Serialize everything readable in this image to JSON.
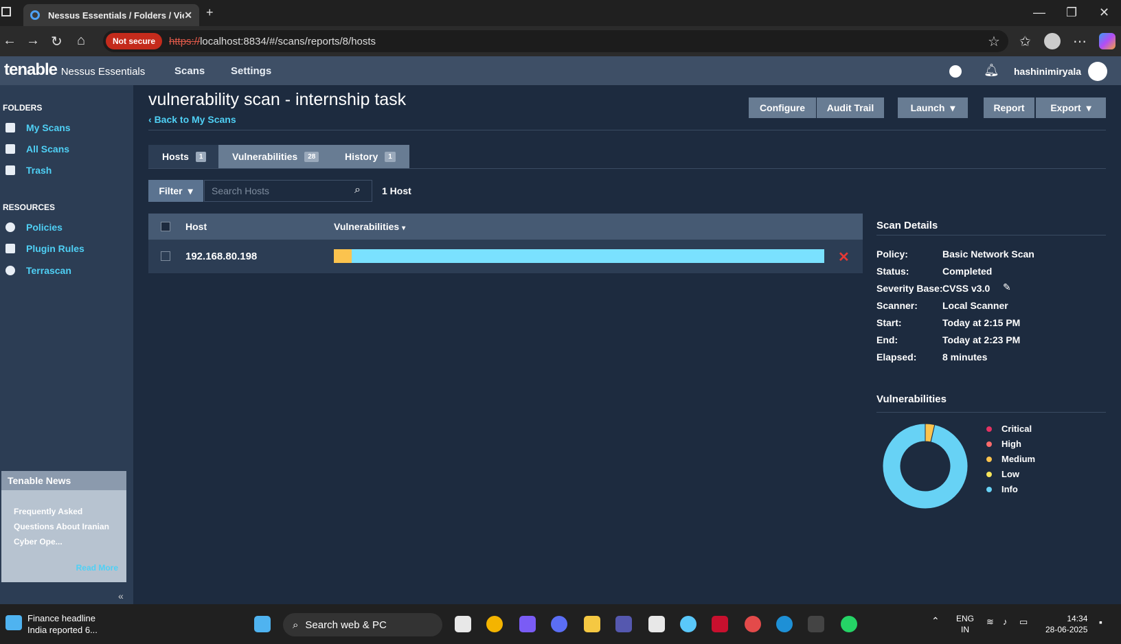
{
  "browser": {
    "tab_title": "Nessus Essentials / Folders / View",
    "not_secure": "Not secure",
    "url_scheme": "https://",
    "url_rest": "localhost:8834/#/scans/reports/8/hosts"
  },
  "app": {
    "logo": "tenable",
    "product": "Nessus Essentials",
    "nav": [
      "Scans",
      "Settings"
    ],
    "user": "hashinimiryala"
  },
  "sidebar": {
    "folders_heading": "FOLDERS",
    "folders": [
      "My Scans",
      "All Scans",
      "Trash"
    ],
    "resources_heading": "RESOURCES",
    "resources": [
      "Policies",
      "Plugin Rules",
      "Terrascan"
    ],
    "news_heading": "Tenable News",
    "news_text": "Frequently Asked Questions About Iranian Cyber Ope...",
    "news_more": "Read More"
  },
  "page": {
    "title": "vulnerability scan - internship task",
    "back": "Back to My Scans",
    "buttons": {
      "configure": "Configure",
      "audit": "Audit Trail",
      "launch": "Launch",
      "report": "Report",
      "export": "Export"
    },
    "tabs": [
      {
        "label": "Hosts",
        "count": "1"
      },
      {
        "label": "Vulnerabilities",
        "count": "28"
      },
      {
        "label": "History",
        "count": "1"
      }
    ],
    "filter": "Filter",
    "search_placeholder": "Search Hosts",
    "host_count": "1 Host",
    "table": {
      "col_host": "Host",
      "col_vulns": "Vulnerabilities",
      "rows": [
        {
          "host": "192.168.80.198",
          "medium": 1,
          "info": 27
        }
      ]
    }
  },
  "scan_details": {
    "heading": "Scan Details",
    "rows": [
      {
        "k": "Policy:",
        "v": "Basic Network Scan"
      },
      {
        "k": "Status:",
        "v": "Completed"
      },
      {
        "k": "Severity Base:",
        "v": "CVSS v3.0"
      },
      {
        "k": "Scanner:",
        "v": "Local Scanner"
      },
      {
        "k": "Start:",
        "v": "Today at 2:15 PM"
      },
      {
        "k": "End:",
        "v": "Today at 2:23 PM"
      },
      {
        "k": "Elapsed:",
        "v": "8 minutes"
      }
    ]
  },
  "vulnerabilities": {
    "heading": "Vulnerabilities",
    "legend": [
      {
        "label": "Critical",
        "color": "#e53262"
      },
      {
        "label": "High",
        "color": "#ff6b6b"
      },
      {
        "label": "Medium",
        "color": "#fbc34e"
      },
      {
        "label": "Low",
        "color": "#f8e55a"
      },
      {
        "label": "Info",
        "color": "#67d2f5"
      }
    ],
    "chart_data": {
      "type": "pie",
      "categories": [
        "Critical",
        "High",
        "Medium",
        "Low",
        "Info"
      ],
      "values": [
        0,
        0,
        1,
        0,
        27
      ]
    }
  },
  "taskbar": {
    "news_title": "Finance headline",
    "news_sub": "India reported 6...",
    "search": "Search web & PC",
    "lang1": "ENG",
    "lang2": "IN",
    "time": "14:34",
    "date": "28-06-2025"
  }
}
